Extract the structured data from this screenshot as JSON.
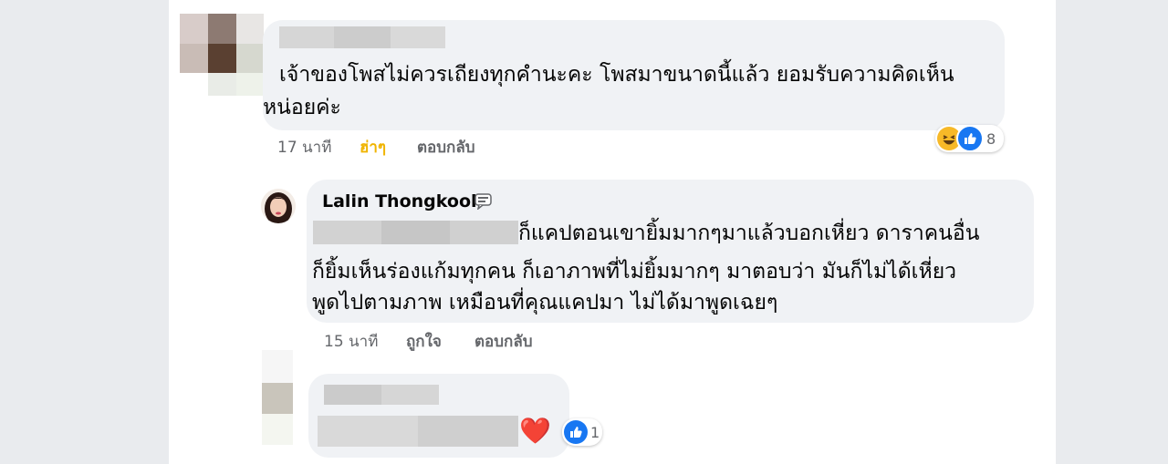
{
  "comments": [
    {
      "text_line1": "เจ้าของโพสไม่ควรเถียงทุกคำนะคะ โพสมาขนาดนี้แล้ว ยอมรับความคิดเห็น",
      "text_line2": "หน่อยค่ะ",
      "time": "17 นาที",
      "reaction_action": "ฮ่าๆ",
      "reply_label": "ตอบกลับ",
      "reaction_count": "8",
      "reaction_icons": [
        "haha-icon",
        "like-icon"
      ],
      "colors": {
        "reaction_action": "#f0b400"
      }
    },
    {
      "author": "Lalin Thongkool",
      "text_line1": "ก็แคปตอนเขายิ้มมากๆมาแล้วบอกเหี่ยว ดาราคนอื่น",
      "text_line2": "ก็ยิ้มเห็นร่องแก้มทุกคน  ก็เอาภาพที่ไม่ยิ้มมากๆ มาตอบว่า มันก็ไม่ได้เหี่ยว",
      "text_line3": "พูดไปตามภาพ เหมือนที่คุณแคปมา ไม่ได้มาพูดเฉยๆ",
      "time": "15 นาที",
      "like_label": "ถูกใจ",
      "reply_label": "ตอบกลับ"
    },
    {
      "emoji": "❤️",
      "reaction_count": "1",
      "reaction_icons": [
        "like-icon"
      ]
    }
  ],
  "colors": {
    "page_bg": "#e9ebee",
    "bubble_bg": "#f0f2f5",
    "like_blue": "#1877f2",
    "heart_red": "#f02849"
  }
}
